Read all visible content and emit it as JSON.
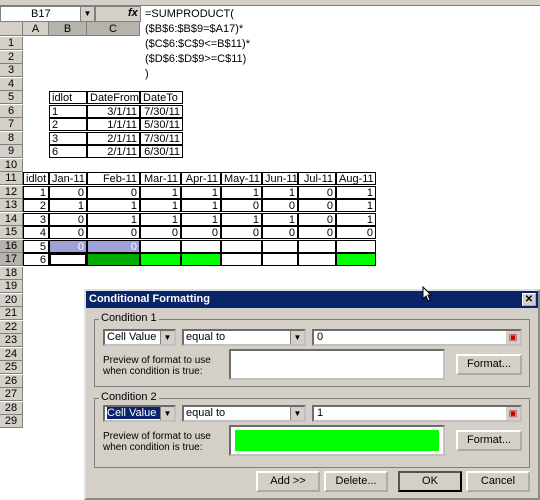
{
  "name_box": "B17",
  "fx": "fx",
  "formula": "=SUMPRODUCT(\n($B$6:$B$9=$A17)*\n($C$6:$C$9<=B$11)*\n($D$6:$D$9>=C$11)\n)",
  "columns": [
    "A",
    "B",
    "C"
  ],
  "rows": [
    "1",
    "2",
    "3",
    "4",
    "5",
    "6",
    "7",
    "8",
    "9",
    "10",
    "11",
    "12",
    "13",
    "14",
    "15",
    "16",
    "17",
    "18",
    "19",
    "20",
    "21",
    "22",
    "23",
    "24",
    "25",
    "26",
    "27",
    "28",
    "29"
  ],
  "table1": {
    "headers": [
      "idlot",
      "DateFrom",
      "DateTo"
    ],
    "rows": [
      [
        "1",
        "3/1/11",
        "7/30/11"
      ],
      [
        "2",
        "1/1/11",
        "5/30/11"
      ],
      [
        "3",
        "2/1/11",
        "7/30/11"
      ],
      [
        "6",
        "2/1/11",
        "6/30/11"
      ]
    ]
  },
  "table2": {
    "headers": [
      "idlot",
      "Jan-11",
      "Feb-11",
      "Mar-11",
      "Apr-11",
      "May-11",
      "Jun-11",
      "Jul-11",
      "Aug-11"
    ],
    "rows": [
      [
        "1",
        "0",
        "0",
        "1",
        "1",
        "1",
        "1",
        "0",
        "1"
      ],
      [
        "2",
        "1",
        "1",
        "1",
        "1",
        "0",
        "0",
        "0",
        "1"
      ],
      [
        "3",
        "0",
        "1",
        "1",
        "1",
        "1",
        "1",
        "0",
        "1"
      ],
      [
        "4",
        "0",
        "0",
        "0",
        "0",
        "0",
        "0",
        "0",
        "0"
      ],
      [
        "5",
        "0",
        "0",
        "",
        "",
        "",
        "",
        "",
        ""
      ],
      [
        "6",
        "",
        "",
        "",
        "",
        "",
        "",
        "",
        ""
      ]
    ]
  },
  "dialog": {
    "title": "Conditional Formatting",
    "close": "✕",
    "condition1": {
      "label": "Condition 1",
      "type": "Cell Value Is",
      "operator": "equal to",
      "value": "0",
      "preview_label_1": "Preview of format to use",
      "preview_label_2": "when condition is true:",
      "format_button": "Format..."
    },
    "condition2": {
      "label": "Condition 2",
      "type": "Cell Value Is",
      "operator": "equal to",
      "value": "1",
      "preview_label_1": "Preview of format to use",
      "preview_label_2": "when condition is true:",
      "format_button": "Format..."
    },
    "buttons": {
      "add": "Add >>",
      "delete": "Delete...",
      "ok": "OK",
      "cancel": "Cancel"
    }
  },
  "colors": {
    "green_fill": "#00ff00",
    "dark_green_fill": "#00aa00",
    "selection": "#a0a0d8",
    "title_bar": "#0a246a"
  }
}
